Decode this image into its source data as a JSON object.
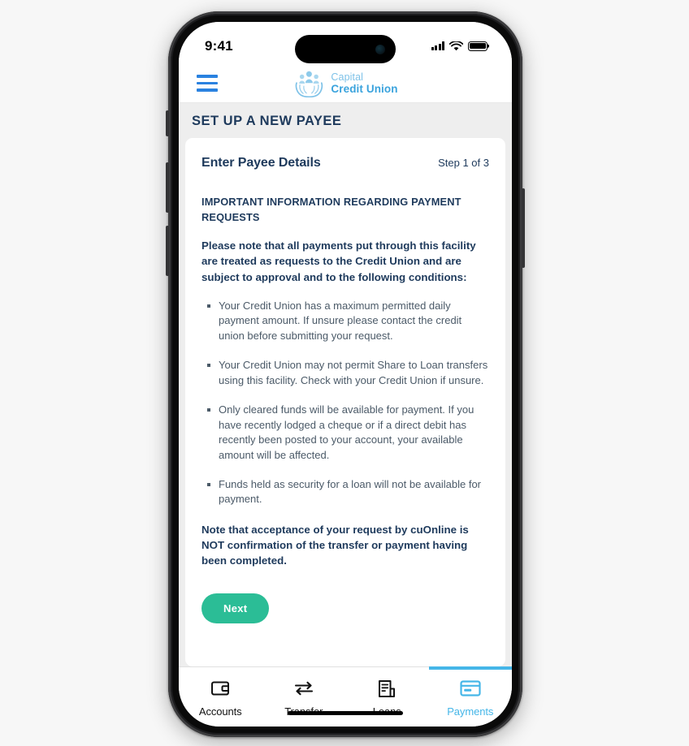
{
  "status_bar": {
    "time": "9:41",
    "signal_icon": "signal-bars-icon",
    "wifi_icon": "wifi-icon",
    "battery_icon": "battery-full-icon"
  },
  "header": {
    "menu_icon": "hamburger-menu-icon",
    "logo_icon": "capital-credit-union-logo",
    "brand_line1": "Capital",
    "brand_line2": "Credit Union"
  },
  "page": {
    "title": "SET UP A NEW PAYEE",
    "background_color": "#eeeeee"
  },
  "card": {
    "title": "Enter Payee Details",
    "step": "Step 1 of 3",
    "notice_heading": "IMPORTANT INFORMATION REGARDING PAYMENT REQUESTS",
    "notice_lead": "Please note that all payments put through this facility are treated as requests to the Credit Union and are subject to approval and to the following conditions:",
    "conditions": [
      "Your Credit Union has a maximum permitted daily payment amount. If unsure please contact the credit union before submitting your request.",
      "Your Credit Union may not permit Share to Loan transfers using this facility. Check with your Credit Union if unsure.",
      "Only cleared funds will be available for payment. If you have recently lodged a cheque or if a direct debit has recently been posted to your account, your available amount will be affected.",
      "Funds held as security for a loan will not be available for payment."
    ],
    "notice_footer": "Note that acceptance of your request by cuOnline is NOT confirmation of the transfer or payment having been completed.",
    "next_label": "Next",
    "next_color": "#2bbd96"
  },
  "tab_bar": {
    "active_color": "#45b6e8",
    "inactive_color": "#111111",
    "tabs": [
      {
        "label": "Accounts",
        "icon": "wallet-icon",
        "active": false
      },
      {
        "label": "Transfer",
        "icon": "transfer-arrows-icon",
        "active": false
      },
      {
        "label": "Loans",
        "icon": "document-icon",
        "active": false
      },
      {
        "label": "Payments",
        "icon": "credit-card-icon",
        "active": true
      }
    ]
  },
  "colors": {
    "brand_blue": "#3aa3dd",
    "menu_blue": "#2a82e0",
    "navy_text": "#1e3a5c",
    "body_text": "#4b5a68"
  }
}
